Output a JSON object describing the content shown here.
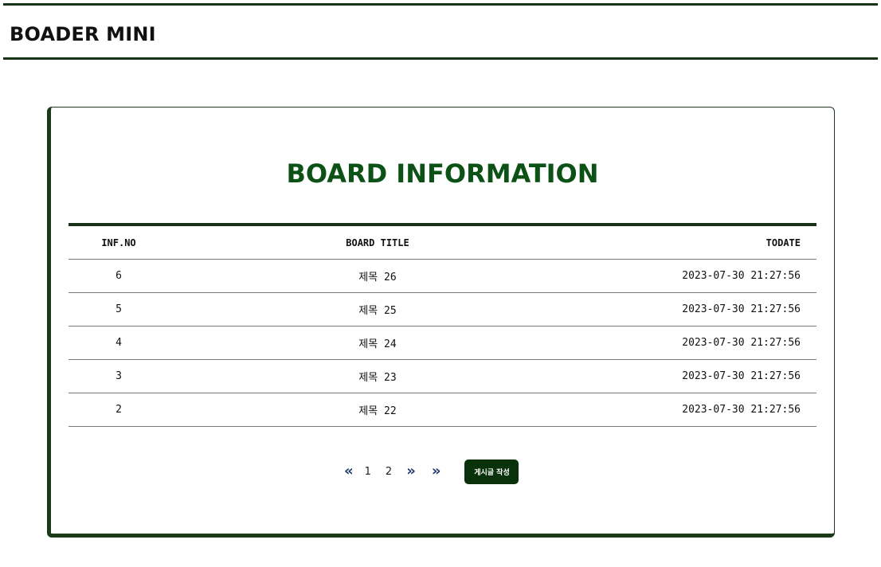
{
  "site": {
    "title": "BOADER MINI"
  },
  "board": {
    "heading": "BOARD INFORMATION",
    "columns": {
      "no": "INF.NO",
      "title": "BOARD TITLE",
      "date": "TODATE"
    },
    "rows": [
      {
        "no": "6",
        "title": "제목 26",
        "date": "2023-07-30 21:27:56"
      },
      {
        "no": "5",
        "title": "제목 25",
        "date": "2023-07-30 21:27:56"
      },
      {
        "no": "4",
        "title": "제목 24",
        "date": "2023-07-30 21:27:56"
      },
      {
        "no": "3",
        "title": "제목 23",
        "date": "2023-07-30 21:27:56"
      },
      {
        "no": "2",
        "title": "제목 22",
        "date": "2023-07-30 21:27:56"
      }
    ]
  },
  "pager": {
    "first_icon": "double-chevron-left-icon",
    "pages": [
      "1",
      "2"
    ],
    "next_icon": "double-chevron-right-icon",
    "last_icon": "double-chevron-right-icon",
    "accent": "#1f3b6e"
  },
  "actions": {
    "write_label": "게시글 작성"
  },
  "colors": {
    "brand": "#0c5216",
    "dark": "#183318",
    "button": "#0a320a"
  }
}
